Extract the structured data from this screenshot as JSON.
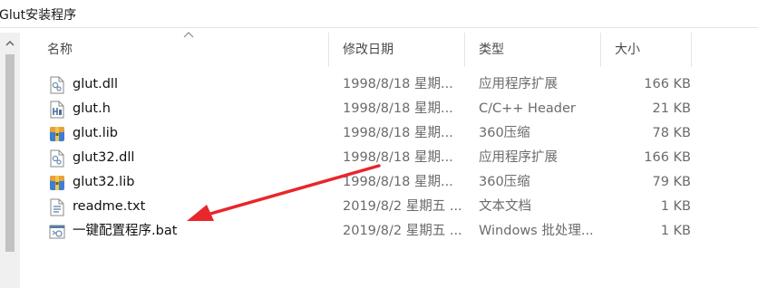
{
  "window": {
    "title": "Glut安装程序"
  },
  "columns": {
    "name": "名称",
    "modified": "修改日期",
    "type": "类型",
    "size": "大小"
  },
  "files": [
    {
      "name": "glut.dll",
      "modified": "1998/8/18 星期...",
      "type": "应用程序扩展",
      "size": "166 KB",
      "icon": "dll-file-icon"
    },
    {
      "name": "glut.h",
      "modified": "1998/8/18 星期...",
      "type": "C/C++ Header",
      "size": "21 KB",
      "icon": "header-file-icon"
    },
    {
      "name": "glut.lib",
      "modified": "1998/8/18 星期...",
      "type": "360压缩",
      "size": "78 KB",
      "icon": "archive-file-icon"
    },
    {
      "name": "glut32.dll",
      "modified": "1998/8/18 星期...",
      "type": "应用程序扩展",
      "size": "166 KB",
      "icon": "dll-file-icon"
    },
    {
      "name": "glut32.lib",
      "modified": "1998/8/18 星期...",
      "type": "360压缩",
      "size": "79 KB",
      "icon": "archive-file-icon"
    },
    {
      "name": "readme.txt",
      "modified": "2019/8/2 星期五 ...",
      "type": "文本文档",
      "size": "1 KB",
      "icon": "text-file-icon"
    },
    {
      "name": "一键配置程序.bat",
      "modified": "2019/8/2 星期五 ...",
      "type": "Windows 批处理...",
      "size": "1 KB",
      "icon": "batch-file-icon"
    }
  ],
  "annotation": {
    "arrow_color": "#e8262b",
    "icon": "red-arrow-annotation"
  }
}
